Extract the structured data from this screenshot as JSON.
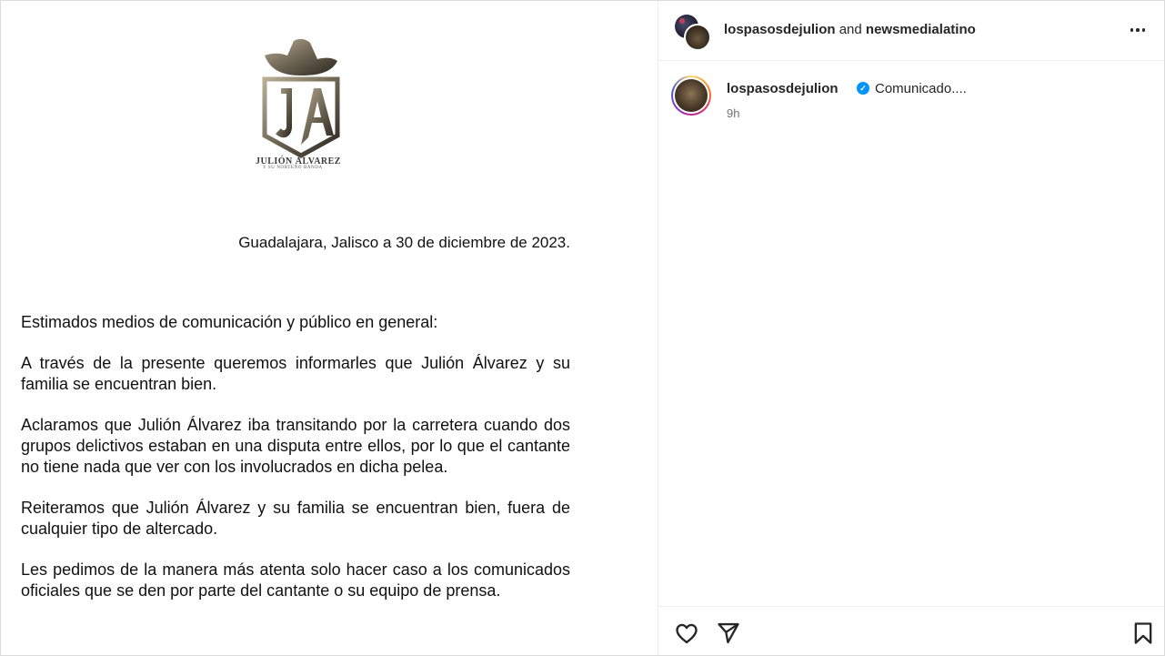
{
  "post": {
    "logo": {
      "name": "Julión Álvarez",
      "subtitle": "y su norteño banda"
    },
    "document": {
      "date_line": "Guadalajara, Jalisco a 30 de diciembre de 2023.",
      "paragraphs": [
        "Estimados medios de comunicación y público en general:",
        "A través de la presente queremos  informarles que Julión Álvarez y su familia se encuentran bien.",
        "Aclaramos que Julión Álvarez iba transitando por la carretera cuando dos grupos delictivos estaban en una disputa entre ellos, por lo que el cantante no tiene nada que ver con los involucrados en dicha pelea.",
        "Reiteramos que Julión Álvarez y su familia se encuentran bien, fuera de cualquier tipo de altercado.",
        "Les pedimos de la manera más atenta solo hacer caso a los comunicados oficiales que se den por parte del cantante o su equipo de prensa."
      ]
    }
  },
  "sidebar": {
    "header": {
      "user1": "lospasosdejulion",
      "connector": " and ",
      "user2": "newsmedialatino",
      "more_icon": "more-horizontal-icon"
    },
    "caption": {
      "username": "lospasosdejulion",
      "verified_icon": "verified-badge-icon",
      "text": "Comunicado....",
      "time": "9h"
    },
    "actions": {
      "like_icon": "heart-icon",
      "share_icon": "send-icon",
      "save_icon": "bookmark-icon"
    }
  },
  "colors": {
    "text": "#262626",
    "muted": "#737373",
    "verified": "#0095f6",
    "border": "#efefef"
  }
}
